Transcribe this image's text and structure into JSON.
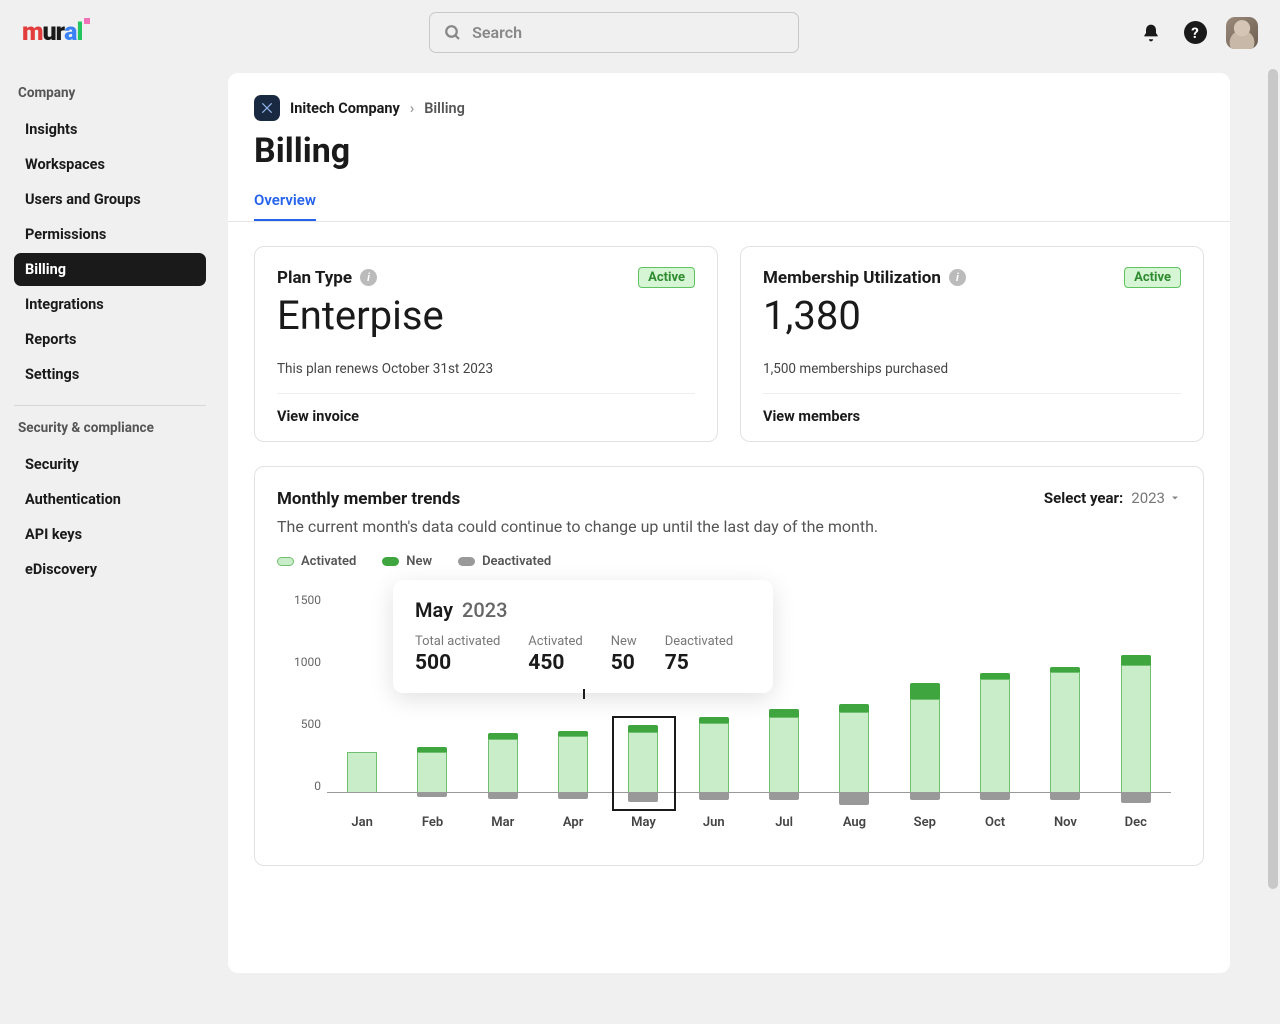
{
  "search_placeholder": "Search",
  "sidebar": {
    "sections": [
      {
        "label": "Company",
        "items": [
          "Insights",
          "Workspaces",
          "Users and Groups",
          "Permissions",
          "Billing",
          "Integrations",
          "Reports",
          "Settings"
        ],
        "active_index": 4
      },
      {
        "label": "Security & compliance",
        "items": [
          "Security",
          "Authentication",
          "API keys",
          "eDiscovery"
        ],
        "active_index": -1
      }
    ]
  },
  "breadcrumb": {
    "company": "Initech Company",
    "page": "Billing"
  },
  "page_title": "Billing",
  "tabs": [
    "Overview"
  ],
  "cards": {
    "plan": {
      "title": "Plan Type",
      "badge": "Active",
      "value": "Enterpise",
      "sub": "This plan renews October 31st 2023",
      "link": "View invoice"
    },
    "membership": {
      "title": "Membership Utilization",
      "badge": "Active",
      "value": "1,380",
      "sub": "1,500 memberships purchased",
      "link": "View members"
    }
  },
  "chart_panel": {
    "title": "Monthly member trends",
    "subtitle": "The current month's data could continue to change up until the last day of the month.",
    "year_label": "Select year:",
    "year_value": "2023",
    "legend": {
      "activated": "Activated",
      "new": "New",
      "deactivated": "Deactivated"
    },
    "tooltip": {
      "month": "May",
      "year": "2023",
      "cols": [
        {
          "lbl": "Total activated",
          "val": "500"
        },
        {
          "lbl": "Activated",
          "val": "450"
        },
        {
          "lbl": "New",
          "val": "50"
        },
        {
          "lbl": "Deactivated",
          "val": "75"
        }
      ]
    }
  },
  "chart_data": {
    "type": "bar",
    "title": "Monthly member trends",
    "xlabel": "",
    "ylabel": "",
    "ylim": [
      0,
      1500
    ],
    "y_ticks": [
      1500,
      1000,
      500,
      0
    ],
    "categories": [
      "Jan",
      "Feb",
      "Mar",
      "Apr",
      "May",
      "Jun",
      "Jul",
      "Aug",
      "Sep",
      "Oct",
      "Nov",
      "Dec"
    ],
    "series": [
      {
        "name": "Activated",
        "values": [
          300,
          300,
          400,
          420,
          450,
          520,
          560,
          600,
          700,
          850,
          900,
          950
        ]
      },
      {
        "name": "New",
        "values": [
          0,
          40,
          40,
          40,
          50,
          40,
          60,
          60,
          120,
          40,
          40,
          80
        ]
      },
      {
        "name": "Deactivated",
        "values": [
          0,
          40,
          50,
          50,
          75,
          60,
          60,
          100,
          60,
          60,
          60,
          80
        ]
      }
    ],
    "highlight_index": 4
  }
}
